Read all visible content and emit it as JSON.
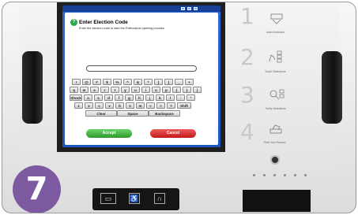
{
  "dialog": {
    "title": "Enter Election Code",
    "message": "Enter the election code to start the Pollbook/do opening process.",
    "input_value": "",
    "accept_label": "Accept",
    "cancel_label": "Cancel"
  },
  "keyboard": {
    "row1": [
      "!",
      "@",
      "#",
      "$",
      "%",
      "^",
      "&",
      "*",
      "(",
      ")",
      "_",
      "+"
    ],
    "row2": [
      "q",
      "w",
      "e",
      "r",
      "t",
      "y",
      "u",
      "i",
      "o",
      "p",
      "{",
      "}",
      "|"
    ],
    "row3": [
      "Shock",
      "a",
      "s",
      "d",
      "f",
      "g",
      "h",
      "j",
      "k",
      "l",
      ":",
      "\""
    ],
    "row4": [
      "z",
      "x",
      "c",
      "v",
      "b",
      "n",
      "m",
      "<",
      ">",
      "?",
      "Shift"
    ],
    "clear_label": "Clear",
    "space_label": "Space",
    "backspace_label": "Backspace"
  },
  "steps": [
    {
      "number": "1",
      "label": "Insert Activator",
      "icon": "card-insert-icon"
    },
    {
      "number": "2",
      "label": "Touch Selections",
      "icon": "touch-hand-icon"
    },
    {
      "number": "3",
      "label": "Verify Selections",
      "icon": "magnifier-icon"
    },
    {
      "number": "4",
      "label": "Print Your Record",
      "icon": "print-record-icon"
    }
  ],
  "step_badge": "7",
  "colors": {
    "screen_blue": "#2a6ad6",
    "accept_green": "#2c9a2c",
    "cancel_red": "#c21a1a",
    "badge_purple": "#7d5aa0"
  }
}
